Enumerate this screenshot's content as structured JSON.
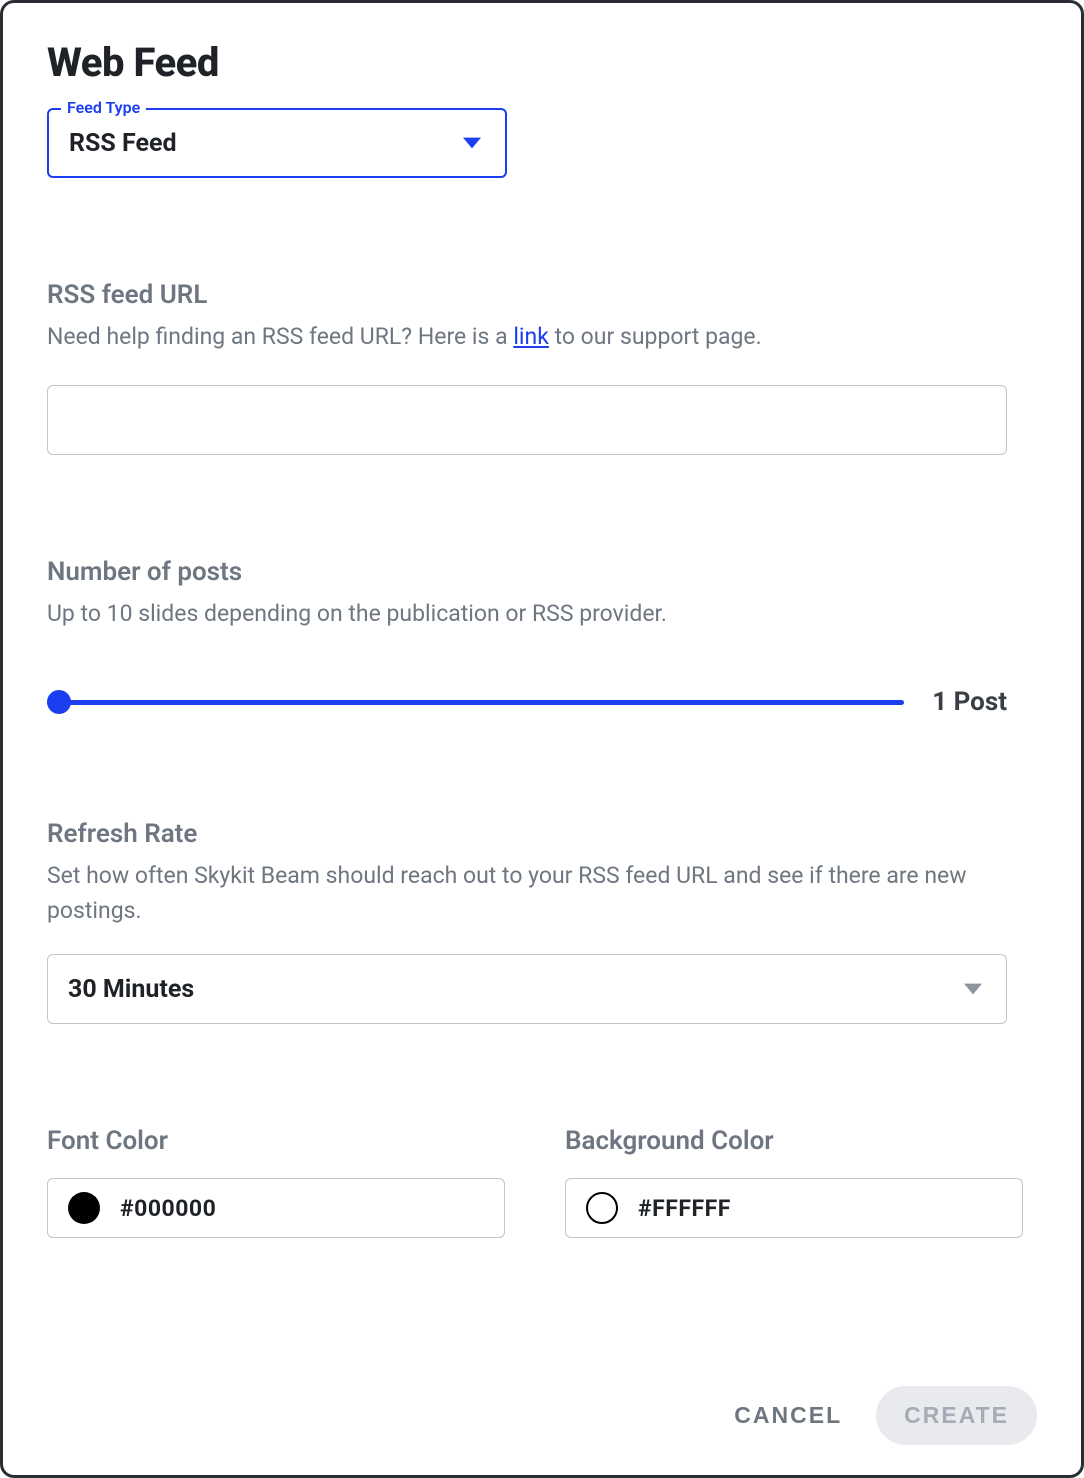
{
  "title": "Web Feed",
  "feed_type": {
    "legend": "Feed Type",
    "value": "RSS Feed"
  },
  "url_section": {
    "label": "RSS feed URL",
    "help_prefix": "Need help finding an RSS feed URL? Here is a ",
    "help_link_text": "link",
    "help_suffix": " to our support page.",
    "value": ""
  },
  "posts_section": {
    "label": "Number of posts",
    "help": "Up to 10 slides depending on the publication or RSS provider.",
    "value_label": "1 Post"
  },
  "refresh_section": {
    "label": "Refresh Rate",
    "help": "Set how often Skykit Beam should reach out to your RSS feed URL and see if there are new postings.",
    "value": "30 Minutes"
  },
  "colors": {
    "font": {
      "label": "Font Color",
      "value": "#000000",
      "hex": "#000000"
    },
    "background": {
      "label": "Background Color",
      "value": "#FFFFFF",
      "hex": "#ffffff"
    }
  },
  "actions": {
    "cancel": "CANCEL",
    "create": "CREATE"
  }
}
